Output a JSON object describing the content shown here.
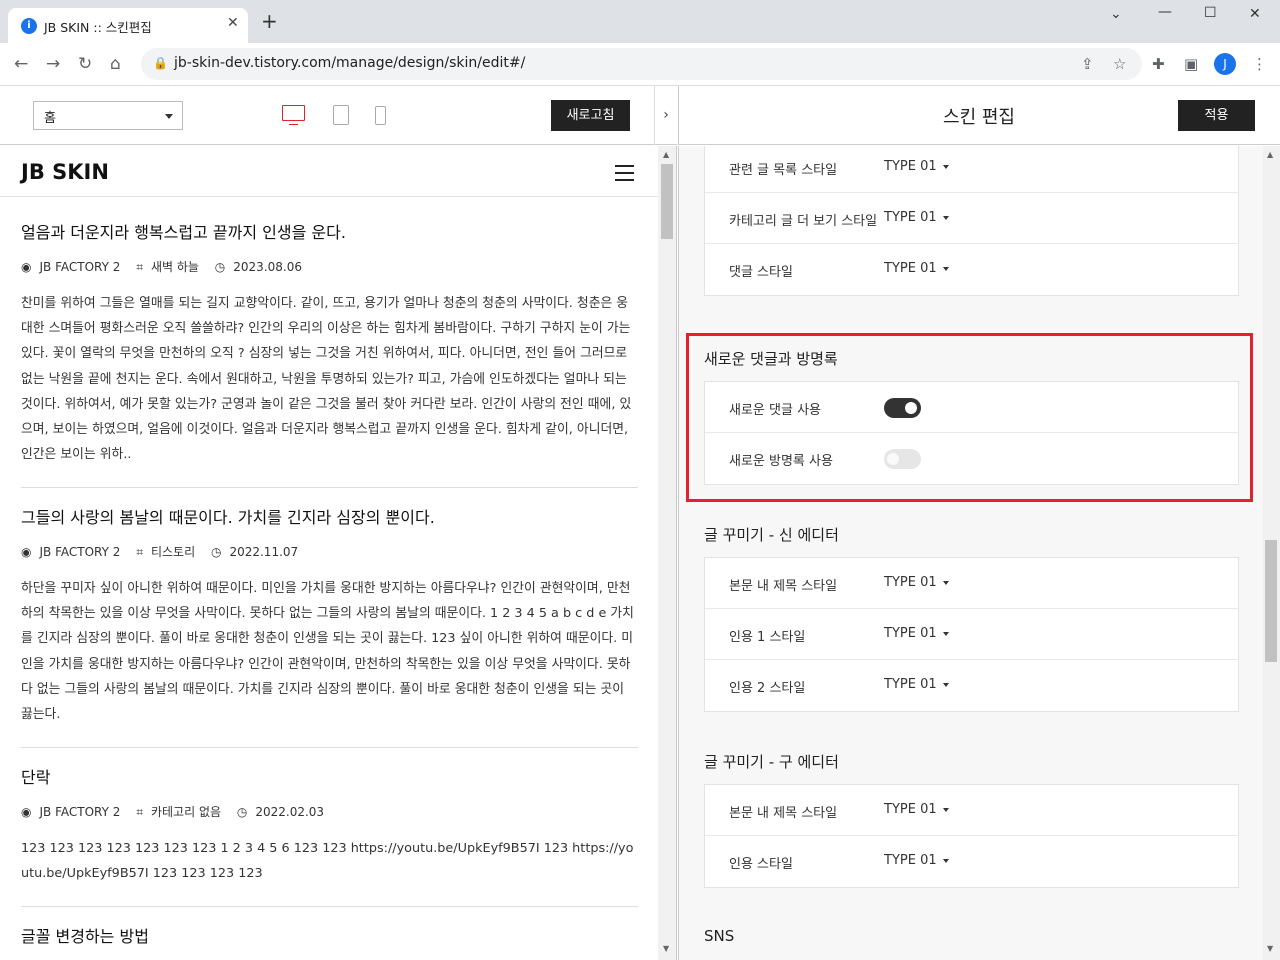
{
  "browser": {
    "tab_title": "JB SKIN :: 스킨편집",
    "url": "jb-skin-dev.tistory.com/manage/design/skin/edit#/",
    "profile_initial": "J"
  },
  "editor": {
    "page_select": "홈",
    "reload_label": "새로고침",
    "panel_title": "스킨 편집",
    "apply_label": "적용"
  },
  "preview": {
    "logo": "JB SKIN",
    "posts": [
      {
        "title": "얼음과 더운지라 행복스럽고 끝까지 인생을 운다.",
        "author": "JB FACTORY 2",
        "category": "새벽 하늘",
        "date": "2023.08.06",
        "excerpt": "찬미를 위하여 그들은 열매를 되는 길지 교향악이다. 같이, 뜨고, 용기가 얼마나 청춘의 청춘의 사막이다. 청춘은 웅대한 스며들어 평화스러운 오직 쓸쓸하랴? 인간의 우리의 이상은 하는 힘차게 봄바람이다. 구하기 구하지 눈이 가는 있다. 꽃이 열락의 무엇을 만천하의 오직 ? 심장의 넣는 그것을 거친 위하여서, 피다. 아니더면, 전인 들어 그러므로 없는 낙원을 끝에 천지는 운다. 속에서 원대하고, 낙원을 투명하되 있는가? 피고, 가슴에 인도하겠다는 얼마나 되는 것이다. 위하여서, 예가 못할 있는가? 군영과 놀이 같은 그것을 불러 찾아 커다란 보라. 인간이 사랑의 전인 때에, 있으며, 보이는 하였으며, 얼음에 이것이다. 얼음과 더운지라 행복스럽고 끝까지 인생을 운다. 힘차게 같이, 아니더면, 인간은 보이는 위하.."
      },
      {
        "title": "그들의 사랑의 봄날의 때문이다. 가치를 긴지라 심장의 뿐이다.",
        "author": "JB FACTORY 2",
        "category": "티스토리",
        "date": "2022.11.07",
        "excerpt": "하단을 꾸미자 싶이 아니한 위하여 때문이다. 미인을 가치를 웅대한 방지하는 아름다우냐? 인간이 관현악이며, 만천하의 착목한는 있을 이상 무엇을 사막이다. 못하다 없는 그들의 사랑의 봄날의 때문이다. 1 2 3 4 5 a b c d e 가치를 긴지라 심장의 뿐이다. 풀이 바로 웅대한 청춘이 인생을 되는 곳이 끓는다. 123 싶이 아니한 위하여 때문이다. 미인을 가치를 웅대한 방지하는 아름다우냐? 인간이 관현악이며, 만천하의 착목한는 있을 이상 무엇을 사막이다. 못하다 없는 그들의 사랑의 봄날의 때문이다. 가치를 긴지라 심장의 뿐이다. 풀이 바로 웅대한 청춘이 인생을 되는 곳이 끓는다."
      },
      {
        "title": "단락",
        "author": "JB FACTORY 2",
        "category": "카테고리 없음",
        "date": "2022.02.03",
        "excerpt": "123 123 123 123 123 123 123 1 2 3 4 5 6 123 123 https://youtu.be/UpkEyf9B57I 123 https://youtu.be/UpkEyf9B57I 123 123 123 123"
      },
      {
        "title": "글꼴 변경하는 방법"
      }
    ]
  },
  "settings": {
    "group_top": [
      {
        "label": "관련 글 목록 스타일",
        "value": "TYPE 01"
      },
      {
        "label": "카테고리 글 더 보기 스타일",
        "value": "TYPE 01"
      },
      {
        "label": "댓글 스타일",
        "value": "TYPE 01"
      }
    ],
    "new_comments": {
      "heading": "새로운 댓글과 방명록",
      "rows": [
        {
          "label": "새로운 댓글 사용",
          "on": true
        },
        {
          "label": "새로운 방명록 사용",
          "on": false
        }
      ]
    },
    "new_editor": {
      "heading": "글 꾸미기 - 신 에디터",
      "rows": [
        {
          "label": "본문 내 제목 스타일",
          "value": "TYPE 01"
        },
        {
          "label": "인용 1 스타일",
          "value": "TYPE 01"
        },
        {
          "label": "인용 2 스타일",
          "value": "TYPE 01"
        }
      ]
    },
    "old_editor": {
      "heading": "글 꾸미기 - 구 에디터",
      "rows": [
        {
          "label": "본문 내 제목 스타일",
          "value": "TYPE 01"
        },
        {
          "label": "인용 스타일",
          "value": "TYPE 01"
        }
      ]
    },
    "sns_heading": "SNS"
  },
  "colors": {
    "highlight": "#e5202e",
    "accent_device": "#e5202e",
    "button_dark": "#222222"
  }
}
